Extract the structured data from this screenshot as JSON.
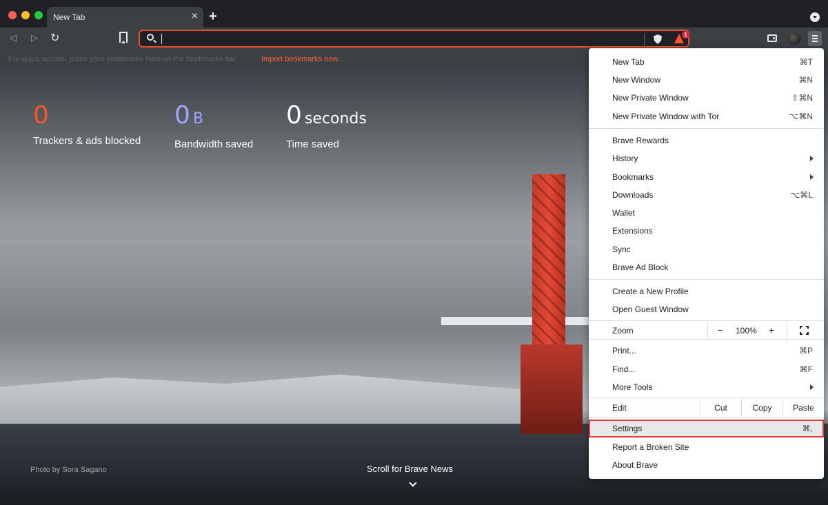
{
  "tab": {
    "title": "New Tab",
    "close": "×",
    "new_tab": "+"
  },
  "toolbar": {
    "back": "◁",
    "forward": "▷",
    "reload": "↻",
    "address_value": "",
    "rewards_badge": "1"
  },
  "bookmarks_bar": {
    "hint": "For quick access, place your bookmarks here on the bookmarks bar.",
    "import_link": "Import bookmarks now..."
  },
  "stats": {
    "trackers": {
      "value": "0",
      "label": "Trackers & ads blocked"
    },
    "bandwidth": {
      "value": "0",
      "unit": "B",
      "label": "Bandwidth saved"
    },
    "time": {
      "value": "0",
      "unit": "seconds",
      "label": "Time saved"
    }
  },
  "photo_credit": "Photo by Sora Sagano",
  "scroll_news": "Scroll for Brave News",
  "menu": {
    "group1": [
      {
        "label": "New Tab",
        "shortcut": "⌘T"
      },
      {
        "label": "New Window",
        "shortcut": "⌘N"
      },
      {
        "label": "New Private Window",
        "shortcut": "⇧⌘N"
      },
      {
        "label": "New Private Window with Tor",
        "shortcut": "⌥⌘N"
      }
    ],
    "group2": [
      {
        "label": "Brave Rewards"
      },
      {
        "label": "History"
      },
      {
        "label": "Bookmarks"
      },
      {
        "label": "Downloads",
        "shortcut": "⌥⌘L"
      },
      {
        "label": "Wallet"
      },
      {
        "label": "Extensions"
      },
      {
        "label": "Sync"
      },
      {
        "label": "Brave Ad Block"
      }
    ],
    "group3": [
      {
        "label": "Create a New Profile"
      },
      {
        "label": "Open Guest Window"
      }
    ],
    "zoom": {
      "label": "Zoom",
      "minus": "−",
      "value": "100%",
      "plus": "+"
    },
    "group4": [
      {
        "label": "Print...",
        "shortcut": "⌘P"
      },
      {
        "label": "Find...",
        "shortcut": "⌘F"
      },
      {
        "label": "More Tools"
      }
    ],
    "edit": {
      "label": "Edit",
      "cut": "Cut",
      "copy": "Copy",
      "paste": "Paste"
    },
    "group5": [
      {
        "label": "Settings",
        "shortcut": "⌘,"
      },
      {
        "label": "Report a Broken Site"
      },
      {
        "label": "About Brave"
      }
    ]
  },
  "colors": {
    "accent": "#fb542b",
    "bandwidth": "#a0a5ff",
    "selection_border": "#e53935"
  }
}
